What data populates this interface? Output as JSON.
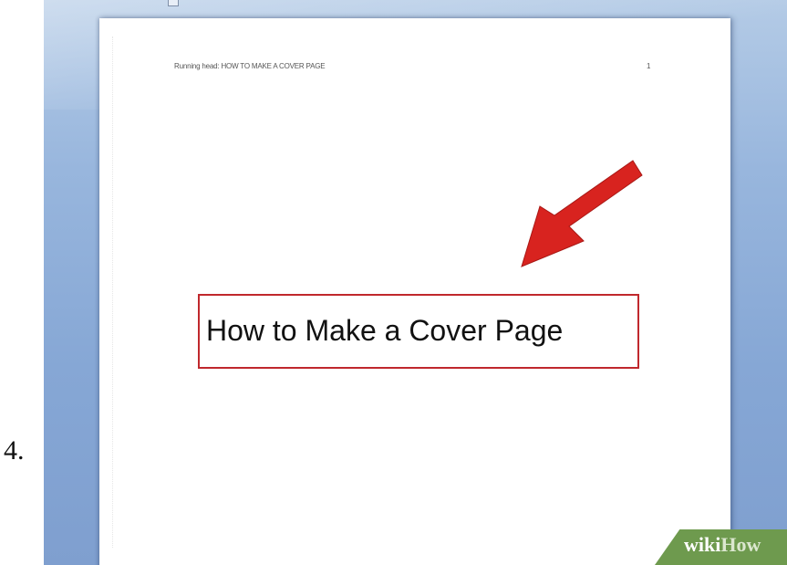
{
  "step": {
    "number": "4."
  },
  "document": {
    "running_head": "Running head: HOW TO MAKE A COVER PAGE",
    "page_number": "1",
    "title": "How to Make a Cover Page"
  },
  "annotation": {
    "highlight_color": "#c0282d",
    "arrow_color": "#d8231f"
  },
  "watermark": {
    "prefix": "wiki",
    "suffix": "How",
    "color": "#6e9a4e"
  },
  "colors": {
    "workspace_background": "#8fb0da",
    "page_background": "#ffffff"
  }
}
